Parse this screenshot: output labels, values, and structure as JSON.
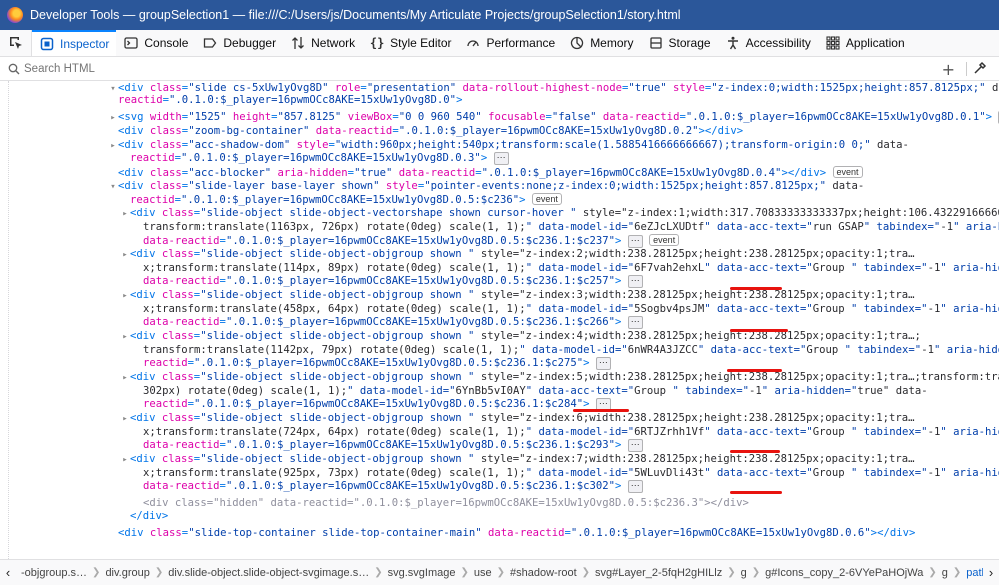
{
  "window": {
    "title": "Developer Tools — groupSelection1 — file:///C:/Users/js/Documents/My Articulate Projects/groupSelection1/story.html"
  },
  "toolbar": {
    "tabs": [
      {
        "label": "Inspector",
        "icon": "inspector-icon"
      },
      {
        "label": "Console",
        "icon": "console-icon"
      },
      {
        "label": "Debugger",
        "icon": "debugger-icon"
      },
      {
        "label": "Network",
        "icon": "network-icon"
      },
      {
        "label": "Style Editor",
        "icon": "style-editor-icon"
      },
      {
        "label": "Performance",
        "icon": "performance-icon"
      },
      {
        "label": "Memory",
        "icon": "memory-icon"
      },
      {
        "label": "Storage",
        "icon": "storage-icon"
      },
      {
        "label": "Accessibility",
        "icon": "accessibility-icon"
      },
      {
        "label": "Application",
        "icon": "application-icon"
      }
    ],
    "active_tab": "Inspector"
  },
  "search": {
    "placeholder": "Search HTML",
    "value": ""
  },
  "markup": {
    "lines": [
      "<div class=\"slide cs-5xUw1yOvg8D\" role=\"presentation\" data-rollout-highest-node=\"true\" style=\"z-index:0;width:1525px;height:857.8125px;\" data-",
      "reactid=\".0.1.0:$_player=16pwmOCc8AKE=15xUw1yOvg8D.0\">",
      "<svg width=\"1525\" height=\"857.8125\" viewBox=\"0 0 960 540\" focusable=\"false\" data-reactid=\".0.1.0:$_player=16pwmOCc8AKE=15xUw1yOvg8D.0.1\">",
      "<div class=\"zoom-bg-container\" data-reactid=\".0.1.0:$_player=16pwmOCc8AKE=15xUw1yOvg8D.0.2\"></div>",
      "<div class=\"acc-shadow-dom\" style=\"width:960px;height:540px;transform:scale(1.5885416666666667);transform-origin:0 0;\" data-",
      "reactid=\".0.1.0:$_player=16pwmOCc8AKE=15xUw1yOvg8D.0.3\">",
      "<div class=\"acc-blocker\" aria-hidden=\"true\" data-reactid=\".0.1.0:$_player=16pwmOCc8AKE=15xUw1yOvg8D.0.4\"></div>",
      "<div class=\"slide-layer base-layer shown\" style=\"pointer-events:none;z-index:0;width:1525px;height:857.8125px;\" data-",
      "reactid=\".0.1.0:$_player=16pwmOCc8AKE=15xUw1yOvg8D.0.5:$c236\">",
      "<div class=\"slide-object slide-object-vectorshape shown cursor-hover \" style=\"z-index:1;width:317.70833333333337px;height:106.432291666666…",
      "transform:translate(1163px, 726px) rotate(0deg) scale(1, 1);\" data-model-id=\"6eZJcLXUDtf\" data-acc-text=\"run GSAP\" tabindex=\"-1\" aria-hidden=\"true\"",
      "data-reactid=\".0.1.0:$_player=16pwmOCc8AKE=15xUw1yOvg8D.0.5:$c236.1:$c237\">",
      "<div class=\"slide-object slide-object-objgroup shown \" style=\"z-index:2;width:238.28125px;height:238.28125px;opacity:1;tra…",
      "x;transform:translate(114px, 89px) rotate(0deg) scale(1, 1);\" data-model-id=\"6F7vah2ehxL\" data-acc-text=\"Group \" tabindex=\"-1\" aria-hidden=\"true\"",
      "data-reactid=\".0.1.0:$_player=16pwmOCc8AKE=15xUw1yOvg8D.0.5:$c236.1:$c257\">",
      "<div class=\"slide-object slide-object-objgroup shown \" style=\"z-index:3;width:238.28125px;height:238.28125px;opacity:1;tra…",
      "x;transform:translate(458px, 64px) rotate(0deg) scale(1, 1);\" data-model-id=\"5Sogbv4psJM\" data-acc-text=\"Group \" tabindex=\"-1\" aria-hidden=\"true\"",
      "data-reactid=\".0.1.0:$_player=16pwmOCc8AKE=15xUw1yOvg8D.0.5:$c236.1:$c266\">",
      "<div class=\"slide-object slide-object-objgroup shown \" style=\"z-index:4;width:238.28125px;height:238.28125px;opacity:1;tra…;",
      "transform:translate(1142px, 79px) rotate(0deg) scale(1, 1);\" data-model-id=\"6nWR4A3JZCC\" data-acc-text=\"Group \" tabindex=\"-1\" aria-hidden=\"true\" data-",
      "reactid=\".0.1.0:$_player=16pwmOCc8AKE=15xUw1yOvg8D.0.5:$c236.1:$c275\">",
      "<div class=\"slide-object slide-object-objgroup shown \" style=\"z-index:5;width:238.28125px;height:238.28125px;opacity:1;tra…;transform:translate(364px,",
      "302px) rotate(0deg) scale(1, 1);\" data-model-id=\"6YnBb5vI0AY\" data-acc-text=\"Group \" tabindex=\"-1\" aria-hidden=\"true\" data-",
      "reactid=\".0.1.0:$_player=16pwmOCc8AKE=15xUw1yOvg8D.0.5:$c236.1:$c284\">",
      "<div class=\"slide-object slide-object-objgroup shown \" style=\"z-index:6;width:238.28125px;height:238.28125px;opacity:1;tra…",
      "x;transform:translate(724px, 64px) rotate(0deg) scale(1, 1);\" data-model-id=\"6RTJZrhh1Vf\" data-acc-text=\"Group \" tabindex=\"-1\" aria-hidden=\"true\"",
      "data-reactid=\".0.1.0:$_player=16pwmOCc8AKE=15xUw1yOvg8D.0.5:$c236.1:$c293\">",
      "<div class=\"slide-object slide-object-objgroup shown \" style=\"z-index:7;width:238.28125px;height:238.28125px;opacity:1;tra…",
      "x;transform:translate(925px, 73px) rotate(0deg) scale(1, 1);\" data-model-id=\"5WLuvDli43t\" data-acc-text=\"Group \" tabindex=\"-1\" aria-hidden=\"true\"",
      "data-reactid=\".0.1.0:$_player=16pwmOCc8AKE=15xUw1yOvg8D.0.5:$c236.1:$c302\">",
      "<div class=\"hidden\" data-reactid=\".0.1.0:$_player=16pwmOCc8AKE=15xUw1yOvg8D.0.5:$c236.3\"></div>",
      "</div>",
      "<div class=\"slide-top-container slide-top-container-main\" data-reactid=\".0.1.0:$_player=16pwmOCc8AKE=15xUw1yOvg8D.0.6\"></div>"
    ],
    "badges": {
      "event": "event",
      "ellipsis": "⋯"
    }
  },
  "breadcrumbs": [
    "-objgroup.s…",
    "div.group",
    "div.slide-object.slide-object-svgimage.s…",
    "svg.svgImage",
    "use",
    "#shadow-root",
    "svg#Layer_2-5fqH2gHILlz",
    "g",
    "g#Icons_copy_2-6VYePaHOjWa",
    "g",
    "path"
  ],
  "colors": {
    "titlebar": "#2b579a",
    "active_tab": "#0a62cc",
    "highlight_marks": "#e8130f"
  }
}
